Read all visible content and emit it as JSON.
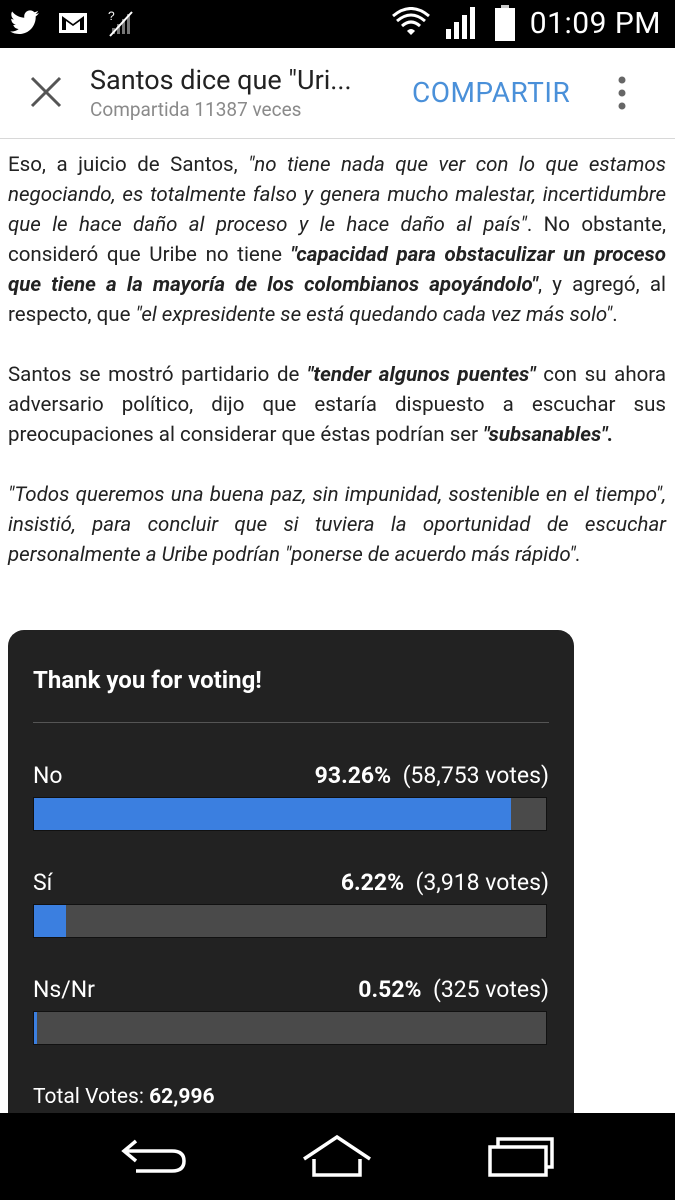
{
  "status_bar": {
    "time": "01:09 PM",
    "icons": [
      "twitter-icon",
      "gmail-icon",
      "no-signal-icon",
      "wifi-icon",
      "signal-icon",
      "battery-icon"
    ]
  },
  "app_bar": {
    "title": "Santos dice que \"Uri...",
    "subtitle": "Compartida 11387 veces",
    "share_label": "COMPARTIR",
    "accent_color": "#4a90d9"
  },
  "article": {
    "p1": [
      {
        "t": "Eso, a juicio de Santos, ",
        "s": ""
      },
      {
        "t": "\"no tiene nada que ver con lo que estamos negociando, es totalmente falso y genera mucho malestar, incertidumbre que le hace daño al proceso y le hace daño al país\"",
        "s": "it"
      },
      {
        "t": ". No obstante, consideró que Uribe no tiene ",
        "s": ""
      },
      {
        "t": "\"capacidad para obstaculizar un proceso que tiene a la mayoría de los colombianos apoyándolo\"",
        "s": "bi"
      },
      {
        "t": ", y agregó, al respecto, que ",
        "s": ""
      },
      {
        "t": "\"el expresidente se está quedando cada vez más solo\"",
        "s": "it"
      },
      {
        "t": ".",
        "s": ""
      }
    ],
    "p2": [
      {
        "t": "Santos se mostró partidario de ",
        "s": ""
      },
      {
        "t": "\"tender algunos puentes\"",
        "s": "bi"
      },
      {
        "t": " con su ahora adversario político, dijo que estaría dispuesto a escuchar sus preocupaciones al considerar que éstas podrían ser ",
        "s": ""
      },
      {
        "t": "\"subsanables\".",
        "s": "bi"
      }
    ],
    "p3": [
      {
        "t": "\"Todos queremos una buena paz, sin impunidad, sostenible en el tiempo\"",
        "s": "it"
      },
      {
        "t": ", insistió, para concluir que si tuviera la oportunidad de escuchar personalmente a Uribe podrían \"ponerse de acuerdo más rápido\"",
        "s": "it"
      },
      {
        "t": ".",
        "s": "it"
      }
    ]
  },
  "poll": {
    "title": "Thank you for voting!",
    "bar_color": "#3b7fe0",
    "options": [
      {
        "label": "No",
        "percent": "93.26%",
        "votes": "(58,753 votes)",
        "fraction": 0.9326
      },
      {
        "label": "Sí",
        "percent": "6.22%",
        "votes": "(3,918 votes)",
        "fraction": 0.0622
      },
      {
        "label": "Ns/Nr",
        "percent": "0.52%",
        "votes": "(325 votes)",
        "fraction": 0.0052
      }
    ],
    "total_label": "Total Votes:",
    "total_value": "62,996"
  },
  "nav_bar": {
    "icons": [
      "back-icon",
      "home-icon",
      "recent-apps-icon"
    ]
  }
}
